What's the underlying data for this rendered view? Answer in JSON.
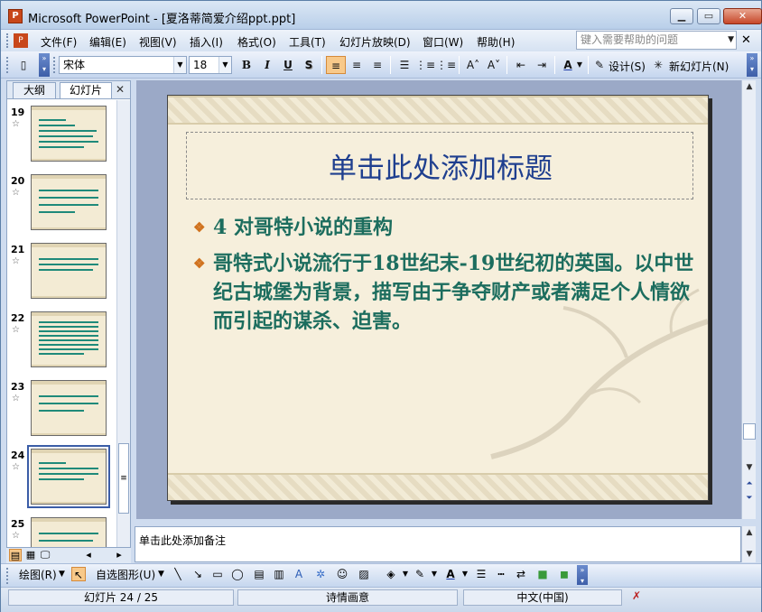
{
  "window": {
    "title": "Microsoft PowerPoint - [夏洛蒂简爱介绍ppt.ppt]",
    "app_icon_letter": "P"
  },
  "menu": {
    "items": [
      "文件(F)",
      "编辑(E)",
      "视图(V)",
      "插入(I)",
      "格式(O)",
      "工具(T)",
      "幻灯片放映(D)",
      "窗口(W)",
      "帮助(H)"
    ],
    "help_placeholder": "键入需要帮助的问题"
  },
  "toolbar": {
    "font": "宋体",
    "font_size": "18",
    "bold": "B",
    "italic": "I",
    "underline": "U",
    "shadow": "S",
    "design_label": "设计(S)",
    "new_slide_label": "新幻灯片(N)"
  },
  "left_pane": {
    "tabs": [
      "大纲",
      "幻灯片"
    ],
    "slides": [
      {
        "num": "19"
      },
      {
        "num": "20"
      },
      {
        "num": "21"
      },
      {
        "num": "22"
      },
      {
        "num": "23"
      },
      {
        "num": "24",
        "selected": true
      },
      {
        "num": "25"
      }
    ]
  },
  "slide": {
    "title": "单击此处添加标题",
    "bullets": [
      "4 对哥特小说的重构",
      "哥特式小说流行于18世纪末-19世纪初的英国。以中世纪古城堡为背景，描写由于争夺财产或者满足个人情欲而引起的谋杀、迫害。"
    ]
  },
  "notes": {
    "placeholder": "单击此处添加备注"
  },
  "draw_toolbar": {
    "draw_label": "绘图(R)",
    "autoshape_label": "自选图形(U)"
  },
  "status": {
    "slide_info": "幻灯片 24 / 25",
    "design": "诗情画意",
    "language": "中文(中国)"
  },
  "colors": {
    "title_blue": "#1f3f8f",
    "body_teal": "#1c6d5e",
    "bullet_orange": "#d0721e"
  }
}
